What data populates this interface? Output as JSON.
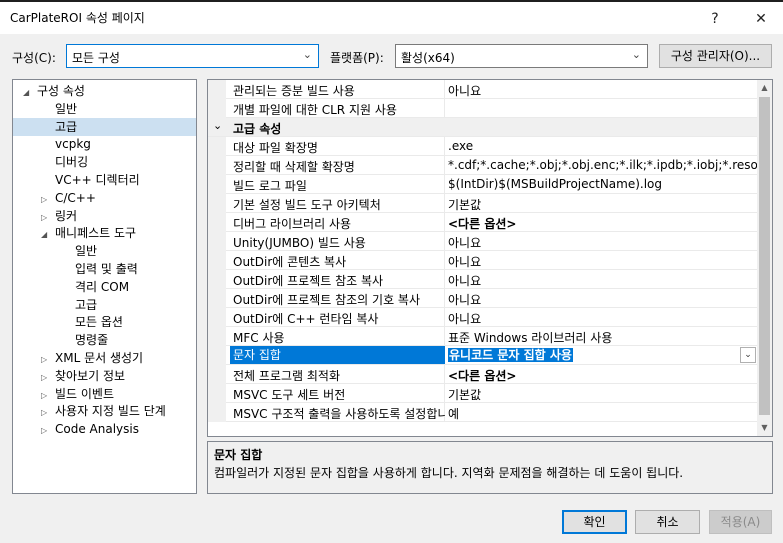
{
  "window": {
    "title": "CarPlateROI 속성 페이지",
    "help": "?",
    "close": "✕"
  },
  "toolbar": {
    "config_label": "구성(C):",
    "config_value": "모든 구성",
    "platform_label": "플랫폼(P):",
    "platform_value": "활성(x64)",
    "config_manager": "구성 관리자(O)..."
  },
  "tree": [
    {
      "label": "구성 속성",
      "arrow": "◢",
      "level": 0
    },
    {
      "label": "일반",
      "arrow": "",
      "level": 1
    },
    {
      "label": "고급",
      "arrow": "",
      "level": 1,
      "selected": true
    },
    {
      "label": "vcpkg",
      "arrow": "",
      "level": 1
    },
    {
      "label": "디버깅",
      "arrow": "",
      "level": 1
    },
    {
      "label": "VC++ 디렉터리",
      "arrow": "",
      "level": 1
    },
    {
      "label": "C/C++",
      "arrow": "▷",
      "level": 1
    },
    {
      "label": "링커",
      "arrow": "▷",
      "level": 1
    },
    {
      "label": "매니페스트 도구",
      "arrow": "◢",
      "level": 1
    },
    {
      "label": "일반",
      "arrow": "",
      "level": 2
    },
    {
      "label": "입력 및 출력",
      "arrow": "",
      "level": 2
    },
    {
      "label": "격리 COM",
      "arrow": "",
      "level": 2
    },
    {
      "label": "고급",
      "arrow": "",
      "level": 2
    },
    {
      "label": "모든 옵션",
      "arrow": "",
      "level": 2
    },
    {
      "label": "명령줄",
      "arrow": "",
      "level": 2
    },
    {
      "label": "XML 문서 생성기",
      "arrow": "▷",
      "level": 1
    },
    {
      "label": "찾아보기 정보",
      "arrow": "▷",
      "level": 1
    },
    {
      "label": "빌드 이벤트",
      "arrow": "▷",
      "level": 1
    },
    {
      "label": "사용자 지정 빌드 단계",
      "arrow": "▷",
      "level": 1
    },
    {
      "label": "Code Analysis",
      "arrow": "▷",
      "level": 1
    }
  ],
  "grid": [
    {
      "name": "관리되는 증분 빌드 사용",
      "value": "아니요"
    },
    {
      "name": "개별 파일에 대한 CLR 지원 사용",
      "value": ""
    },
    {
      "name": "고급 속성",
      "value": "",
      "category": true,
      "expander": "⌄"
    },
    {
      "name": "대상 파일 확장명",
      "value": ".exe"
    },
    {
      "name": "정리할 때 삭제할 확장명",
      "value": "*.cdf;*.cache;*.obj;*.obj.enc;*.ilk;*.ipdb;*.iobj;*.resources;*.tl"
    },
    {
      "name": "빌드 로그 파일",
      "value": "$(IntDir)$(MSBuildProjectName).log"
    },
    {
      "name": "기본 설정 빌드 도구 아키텍처",
      "value": "기본값"
    },
    {
      "name": "디버그 라이브러리 사용",
      "value": "<다른 옵션>",
      "bold": true
    },
    {
      "name": "Unity(JUMBO) 빌드 사용",
      "value": "아니요"
    },
    {
      "name": "OutDir에 콘텐츠 복사",
      "value": "아니요"
    },
    {
      "name": "OutDir에 프로젝트 참조 복사",
      "value": "아니요"
    },
    {
      "name": "OutDir에 프로젝트 참조의 기호 복사",
      "value": "아니요"
    },
    {
      "name": "OutDir에 C++ 런타임 복사",
      "value": "아니요"
    },
    {
      "name": "MFC 사용",
      "value": "표준 Windows 라이브러리 사용"
    },
    {
      "name": "문자 집합",
      "value": "유니코드 문자 집합 사용",
      "selected": true
    },
    {
      "name": "전체 프로그램 최적화",
      "value": "<다른 옵션>",
      "bold": true
    },
    {
      "name": "MSVC 도구 세트 버전",
      "value": "기본값"
    },
    {
      "name": "MSVC 구조적 출력을 사용하도록 설정합니다",
      "value": "예"
    }
  ],
  "description": {
    "title": "문자 집합",
    "text": "컴파일러가 지정된 문자 집합을 사용하게 합니다. 지역화 문제점을 해결하는 데 도움이 됩니다."
  },
  "buttons": {
    "ok": "확인",
    "cancel": "취소",
    "apply": "적용(A)"
  },
  "icons": {
    "chevron": "⌄",
    "scroll_up": "▲",
    "scroll_down": "▼",
    "dropdown": "⌄"
  }
}
